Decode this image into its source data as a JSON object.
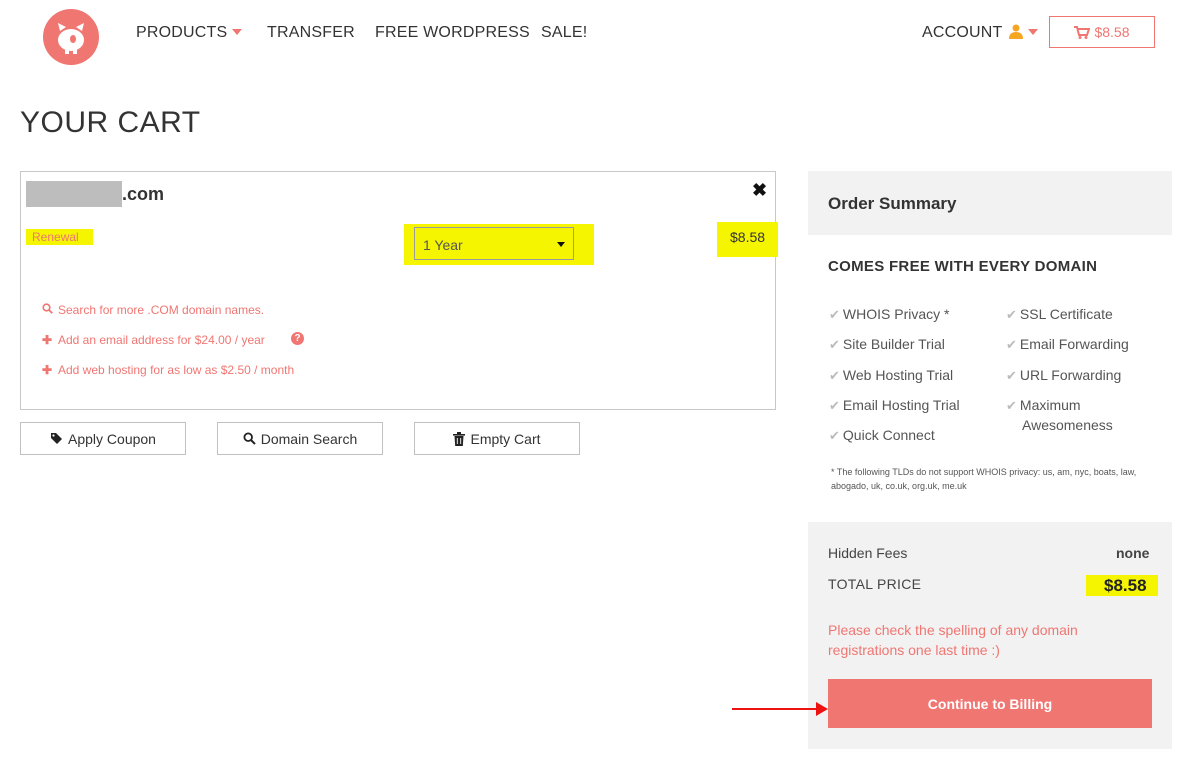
{
  "header": {
    "nav": [
      "PRODUCTS",
      "TRANSFER",
      "FREE WORDPRESS",
      "SALE!"
    ],
    "account_label": "ACCOUNT",
    "cart_total": "$8.58"
  },
  "page": {
    "title": "YOUR CART"
  },
  "cart_item": {
    "domain_tld": ".com",
    "remove_symbol": "✖",
    "type_label": "Renewal",
    "term": "1 Year",
    "price": "$8.58",
    "links": {
      "search": "Search for more .COM domain names.",
      "email": "Add an email address for $24.00 / year",
      "hosting": "Add web hosting for as low as $2.50 / month"
    }
  },
  "actions": {
    "apply_coupon": "Apply Coupon",
    "domain_search": "Domain Search",
    "empty_cart": "Empty Cart"
  },
  "summary": {
    "title": "Order Summary",
    "free_title": "COMES FREE WITH EVERY DOMAIN",
    "features_left": [
      "WHOIS Privacy *",
      "Site Builder Trial",
      "Web Hosting Trial",
      "Email Hosting Trial",
      "Quick Connect"
    ],
    "features_right": [
      "SSL Certificate",
      "Email Forwarding",
      "URL Forwarding",
      "Maximum",
      "Awesomeness"
    ],
    "note": "* The following TLDs do not support WHOIS privacy: us, am, nyc, boats, law, abogado, uk, co.uk, org.uk, me.uk",
    "hidden_fees_label": "Hidden Fees",
    "hidden_fees_value": "none",
    "total_label": "TOTAL PRICE",
    "total_value": "$8.58",
    "spelling_note": "Please check the spelling of any domain registrations one last time :)",
    "continue_label": "Continue to Billing"
  },
  "colors": {
    "brand": "#f07672",
    "highlight": "#f5f500",
    "arrow": "#ee1111"
  },
  "icons": [
    "logo-icon",
    "caret-down-icon",
    "user-icon",
    "cart-icon",
    "close-icon",
    "search-icon",
    "plus-icon",
    "question-icon",
    "tag-icon",
    "trash-icon",
    "check-icon"
  ]
}
